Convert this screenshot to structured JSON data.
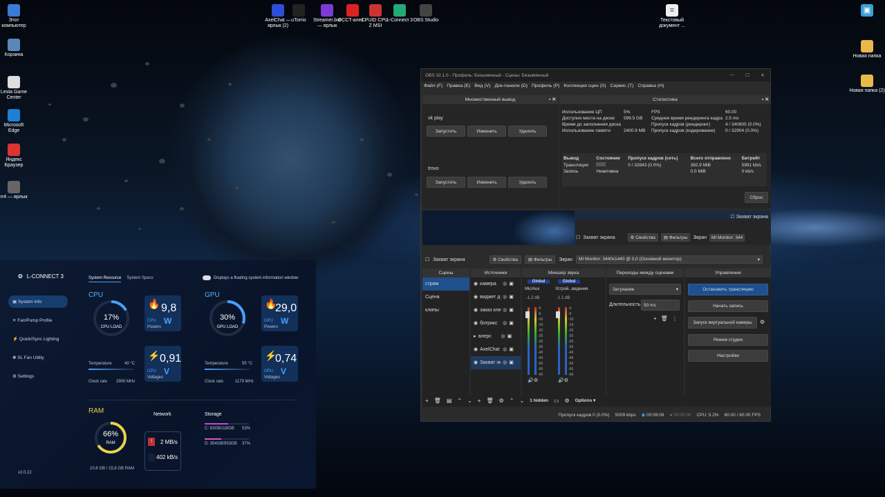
{
  "desktop": {
    "icons_left": [
      {
        "label": "Этот компьютер",
        "icon": "computer-icon"
      },
      {
        "label": "Корзина",
        "icon": "trash-icon"
      },
      {
        "label": "Lesta Game Center",
        "icon": "game-icon"
      },
      {
        "label": "Microsoft Edge",
        "icon": "edge-icon"
      },
      {
        "label": "Яндекс Браузер",
        "icon": "yandex-icon"
      },
      {
        "label": "rr4 — ярлык",
        "icon": "shortcut-icon"
      }
    ],
    "icons_top": [
      {
        "label": "AxelChat — ярлык (2)"
      },
      {
        "label": "uTorrio"
      },
      {
        "label": "Streamer.bot — ярлык"
      },
      {
        "label": "OCCT-алек..."
      },
      {
        "label": "CPUID CPU-Z MSI"
      },
      {
        "label": "L-Connect 3"
      },
      {
        "label": "OBS Studio"
      }
    ],
    "icon_text_doc": "Текстовый документ ...",
    "icons_right": [
      {
        "label": ""
      },
      {
        "label": "Новая папка"
      },
      {
        "label": "Новая папка (2)"
      }
    ]
  },
  "obs": {
    "title": "OBS 32.1.0 - Профиль: Безымянный - Сцены: Безымянный",
    "menu": [
      "Файл (F)",
      "Правка (E)",
      "Вид (V)",
      "Док-панели (D)",
      "Профиль (P)",
      "Коллекция сцен (S)",
      "Сервис (T)",
      "Справка (H)"
    ],
    "multi": {
      "title": "Множественный вывод",
      "targets": [
        {
          "name": "vk play"
        },
        {
          "name": "trovo"
        }
      ],
      "start": "Запустить",
      "edit": "Изменить",
      "delete": "Удалить"
    },
    "stats": {
      "title": "Статистика",
      "rows": [
        [
          "Использование ЦП",
          "5%",
          "FPS",
          "60.00"
        ],
        [
          "Доступно места на диске",
          "599.5 GB",
          "Среднее время рендеринга кадра",
          "2.5 ms"
        ],
        [
          "Время до заполнения диска",
          "",
          "Пропуск кадров (рендеринг)",
          "4 / 340805 (0.0%)"
        ],
        [
          "Использование памяти",
          "2400.9 MB",
          "Пропуск кадров (кодирование)",
          "0 / 32904 (0.0%)"
        ]
      ],
      "out_head": [
        "Вывод",
        "Состояние",
        "Пропуск кадров (сеть)",
        "Всего отправлено",
        "Битрейт"
      ],
      "out_rows": [
        [
          "Трансляция",
          "",
          "0 / 32843 (0.0%)",
          "392.9 MiB",
          "5991 kb/s"
        ],
        [
          "Запись",
          "Неактивна",
          "",
          "0.0 MiB",
          "0 kb/s"
        ]
      ],
      "reset": "Сброс"
    },
    "preview": {
      "capture_label": "Захват экрана",
      "props": "Свойства",
      "filters": "Фильтры",
      "screen_label": "Экран",
      "screen_val": "MI Monitor: 344"
    },
    "source_bar": {
      "source": "Захват экрана",
      "props": "Свойства",
      "filters": "Фильтры",
      "screen": "Экран",
      "screen_val": "MI Monitor: 3440x1440 @ 0,0 (Основной монитор)"
    },
    "scenes": {
      "title": "Сцены",
      "items": [
        "стрим",
        "Сцена",
        "клипы"
      ]
    },
    "sources": {
      "title": "Источники",
      "items": [
        "камера",
        "виджет д",
        "заказ кли",
        "ботрикс",
        "алерс",
        "AxelChat",
        "Захват эк"
      ]
    },
    "mixer": {
      "title": "Микшер звука",
      "ch": [
        {
          "name": "Mic/Aux",
          "tag": "Global",
          "db": "-1.2 dB"
        },
        {
          "name": "Устрой...ведения",
          "tag": "Global",
          "db": "-1.1 dB"
        }
      ],
      "scale": [
        "-0",
        "-5",
        "-10",
        "-15",
        "-20",
        "-25",
        "-30",
        "-35",
        "-40",
        "-45",
        "-50",
        "-55",
        "-60"
      ],
      "hidden": "1 hidden",
      "options": "Options"
    },
    "trans": {
      "title": "Переходы между сценами",
      "type": "Затухание",
      "dur_label": "Длительность",
      "dur": "50 ms"
    },
    "controls": {
      "title": "Управление",
      "buttons": [
        "Остановить трансляцию",
        "Начать запись",
        "Запуск виртуальной камеры",
        "Режим студии",
        "Настройки"
      ]
    },
    "status": {
      "dropped": "Пропуск кадров 0 (0.0%)",
      "kbps": "5009 kbps",
      "stream_time": "00:09:08",
      "rec_time": "00:00:00",
      "cpu": "CPU: 5.2%",
      "fps": "60.00 / 60.00 FPS"
    }
  },
  "lconnect": {
    "app": "L-CONNECT 3",
    "tabs": [
      "System Resource",
      "System Specs"
    ],
    "floating": "Displays a floating system information window",
    "nav": [
      "System Info",
      "Fan/Pump Profile",
      "Quick/Sync Lighting",
      "SL Fan Utility",
      "Settings"
    ],
    "cpu": {
      "label": "CPU",
      "load": "17%",
      "load_label": "CPU LOAD",
      "load_frac": 0.17,
      "power": "9,8",
      "power_unit": "W",
      "power_label": "Powers",
      "volt": "0,91",
      "volt_unit": "V",
      "volt_label": "Voltages",
      "temp_label": "Temperature",
      "temp": "40 °C",
      "clock_label": "Clock rate",
      "clock": "2900 MHz"
    },
    "gpu": {
      "label": "GPU",
      "load": "30%",
      "load_label": "GPU LOAD",
      "load_frac": 0.3,
      "power": "29,0",
      "power_unit": "W",
      "power_label": "Powers",
      "volt": "0,74",
      "volt_unit": "V",
      "volt_label": "Voltages",
      "temp_label": "Temperature",
      "temp": "55 °C",
      "clock_label": "Clock rate",
      "clock": "1179 MHz"
    },
    "ram": {
      "label": "RAM",
      "pct": "66%",
      "sub": "RAM",
      "frac": 0.66,
      "usage": "10,6 GB / 15,8 GB RAM"
    },
    "network": {
      "label": "Network",
      "up": "2 MB/s",
      "down": "402 kB/s"
    },
    "storage": {
      "label": "Storage",
      "drives": [
        {
          "name": "C: 63GB/118GB",
          "pct": "53%",
          "frac": 0.53
        },
        {
          "name": "D: 354GB/953GB",
          "pct": "37%",
          "frac": 0.37
        }
      ]
    },
    "version": "v2.0.22"
  }
}
